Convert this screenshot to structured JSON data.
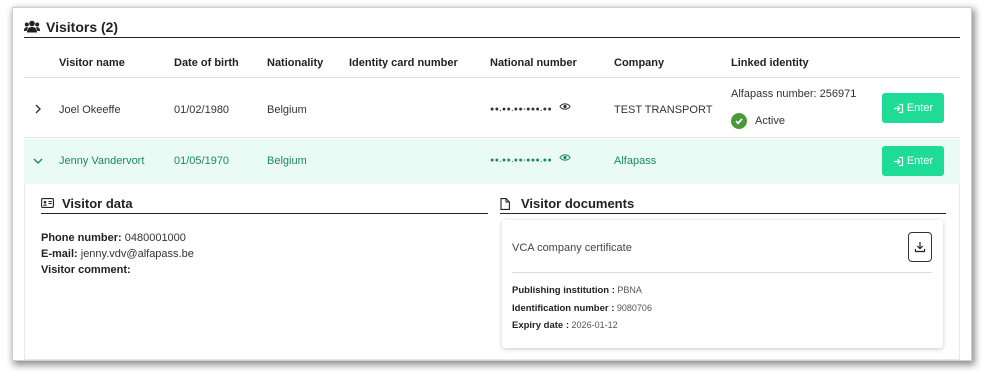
{
  "section": {
    "title": "Visitors (2)",
    "icon": "users-icon"
  },
  "columns": [
    "Visitor name",
    "Date of birth",
    "Nationality",
    "Identity card number",
    "National number",
    "Company",
    "Linked identity"
  ],
  "visitors": [
    {
      "name": "Joel Okeeffe",
      "dob": "01/02/1980",
      "nationality": "Belgium",
      "id_card": "",
      "national_number": "●●.●●.●●-●●●.●●",
      "company": "TEST TRANSPORT",
      "linked_identity": "Alfapass number: 256971",
      "status": "Active",
      "enter_label": "Enter",
      "expanded": false
    },
    {
      "name": "Jenny Vandervort",
      "dob": "01/05/1970",
      "nationality": "Belgium",
      "id_card": "",
      "national_number": "●●.●●.●●-●●●.●●",
      "company": "Alfapass",
      "linked_identity": "",
      "enter_label": "Enter",
      "expanded": true
    }
  ],
  "visitor_data": {
    "title": "Visitor data",
    "phone_label": "Phone number:",
    "phone": "0480001000",
    "email_label": "E-mail:",
    "email": "jenny.vdv@alfapass.be",
    "comment_label": "Visitor comment:"
  },
  "visitor_documents": {
    "title": "Visitor documents",
    "doc_title": "VCA company certificate",
    "publishing_label": "Publishing institution :",
    "publishing": "PBNA",
    "identification_label": "Identification number :",
    "identification": "9080706",
    "expiry_label": "Expiry date :",
    "expiry": "2026-01-12"
  },
  "colors": {
    "accent": "#1edc95",
    "active_green": "#4a9a3a",
    "expanded_row_bg": "#eafaf4",
    "expanded_text": "#1d8a5c"
  }
}
